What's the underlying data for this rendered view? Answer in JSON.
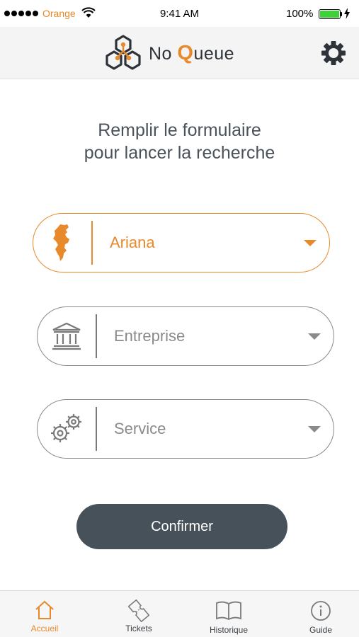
{
  "status_bar": {
    "carrier": "Orange",
    "time": "9:41 AM",
    "battery": "100%"
  },
  "header": {
    "logo_prefix": "No ",
    "logo_q": "Q",
    "logo_suffix": "ueue"
  },
  "form": {
    "title_line1": "Remplir le formulaire",
    "title_line2": "pour lancer la recherche",
    "fields": [
      {
        "value": "Ariana",
        "icon": "tunisia-map-icon",
        "active": true
      },
      {
        "value": "Entreprise",
        "icon": "bank-icon",
        "active": false
      },
      {
        "value": "Service",
        "icon": "gears-icon",
        "active": false
      }
    ],
    "confirm_label": "Confirmer"
  },
  "tabbar": {
    "tabs": [
      {
        "label": "Accueil",
        "icon": "home-icon",
        "active": true
      },
      {
        "label": "Tickets",
        "icon": "ticket-icon",
        "active": false
      },
      {
        "label": "Historique",
        "icon": "book-icon",
        "active": false
      },
      {
        "label": "Guide",
        "icon": "info-icon",
        "active": false
      }
    ]
  },
  "colors": {
    "accent": "#e8892b",
    "button": "#465159",
    "text": "#4a525a"
  }
}
